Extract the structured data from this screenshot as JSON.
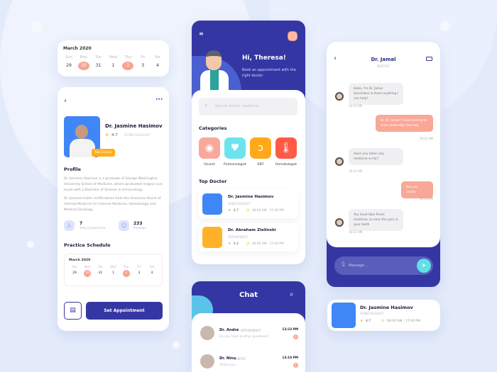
{
  "calendar": {
    "month": "March 2020",
    "weekdays": [
      "Sun",
      "Mon",
      "Tue",
      "Wed",
      "Thu",
      "Fri",
      "Sat"
    ],
    "days": [
      "29",
      "30",
      "31",
      "1",
      "2",
      "3",
      "4"
    ],
    "highlighted": [
      "30",
      "2"
    ]
  },
  "profile": {
    "name": "Dr. Jasmine Hasimov",
    "rating": "4.7",
    "specialty": "GYNECOLOGIST",
    "badge": "Top Doctor",
    "section_profile": "Profile",
    "bio1": "Dr. Jasmine Hasimov is a graduate of George Washington University School of Medicine, where graduated magna cum laude with a Bachelor of Science in Immunology.",
    "bio2": "Dr. Jasmine holds certifications from the American Board of Internal Medicine for Internal Medicine, Hematology and Medical Oncology.",
    "experience_value": "7",
    "experience_label": "Years Experience",
    "reviews_value": "233",
    "reviews_label": "Reviews",
    "schedule_title": "Practice Schedule",
    "set_appointment": "Set Appointment"
  },
  "home": {
    "greeting": "Hi, Theresa!",
    "subtitle": "Book an appointment with the right doctor",
    "search_placeholder": "Search doctor, medicine ...",
    "categories_title": "Categories",
    "categories": [
      {
        "label": "Oculist",
        "icon": "eye-icon",
        "color": "#f9a99a"
      },
      {
        "label": "Pulmonologist",
        "icon": "heart-pulse-icon",
        "color": "#6ce3ee"
      },
      {
        "label": "ENT",
        "icon": "ear-icon",
        "color": "#ffa91a"
      },
      {
        "label": "Hematologist",
        "icon": "thermometer-icon",
        "color": "#ff5a45"
      }
    ],
    "top_doctor_title": "Top Doctor",
    "doctors": [
      {
        "name": "Dr. Jasmine Hasimov",
        "specialty": "GYNECOLOGIST",
        "rating": "4.7",
        "hours": "08:00 AM - 17:00 PM",
        "color": "#3f86f7"
      },
      {
        "name": "Dr. Abraham Zielinski",
        "specialty": "ORTHOPEDIST",
        "rating": "4.2",
        "hours": "09:00 AM - 15:00 PM",
        "color": "#ffb229"
      }
    ]
  },
  "chat_list": {
    "title": "Chat",
    "items": [
      {
        "name": "Dr. Andre",
        "specialty": "ORTHOPEDIST",
        "time": "13:23 PM",
        "message": "Do you have another questions?",
        "unread": "2"
      },
      {
        "name": "Dr. Nina",
        "specialty": "DENTIST",
        "time": "13:10 PM",
        "message": "Thank you",
        "unread": "1"
      }
    ]
  },
  "conversation": {
    "name": "Dr. Jamal",
    "specialty": "DENTIST",
    "message_placeholder": "Message...",
    "messages": [
      {
        "from": "doctor",
        "text": "Hello, I'm Dr. Jamal Smulnikov Is there anything I can help?",
        "time": "10:21 AM"
      },
      {
        "from": "me",
        "text": "Hi, Dr. Jamal! I have toothache since yesterday morning",
        "time": "10:21 AM"
      },
      {
        "from": "doctor",
        "text": "Have you taken any medicine so far?",
        "time": "10:21 AM"
      },
      {
        "from": "me",
        "text": "Not yet, doctor",
        "time": "10:21 AM"
      },
      {
        "from": "doctor",
        "text": "You must take Proris medicine, to ease the pain in your teeth",
        "time": "10:21 AM"
      }
    ]
  },
  "mini_card": {
    "name": "Dr. Jasmine Hasimov",
    "specialty": "GYNECOLOGIST",
    "rating": "4.7",
    "hours": "08:00 AM - 17:00 PM"
  },
  "colors": {
    "primary": "#3437a3",
    "accent": "#f9a796",
    "star": "#ffae1a",
    "background": "#e3ebfb"
  }
}
